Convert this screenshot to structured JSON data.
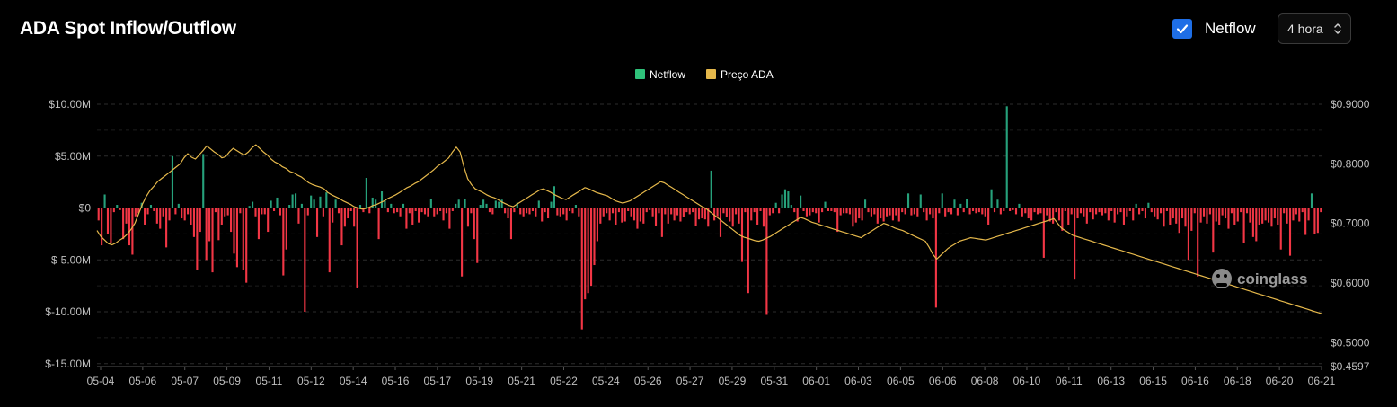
{
  "header": {
    "title": "ADA Spot Inflow/Outflow",
    "netflow_toggle": {
      "label": "Netflow",
      "checked": true
    },
    "interval_select": {
      "value": "4 hora"
    }
  },
  "watermark": "coinglass",
  "colors": {
    "inflow": "#26a17b",
    "outflow": "#f23645",
    "price": "#e5b84b",
    "legend_netflow": "#2fc27a",
    "grid": "#2c2c2c",
    "axis_text": "#bfbfbf",
    "checkbox": "#1e6ee6"
  },
  "chart_data": {
    "type": "bar",
    "title": "ADA Spot Inflow/Outflow",
    "legend": {
      "position": "top-center",
      "items": [
        "Netflow",
        "Preço ADA"
      ]
    },
    "x_ticks": [
      "05-04",
      "05-06",
      "05-07",
      "05-09",
      "05-11",
      "05-12",
      "05-14",
      "05-16",
      "05-17",
      "05-19",
      "05-21",
      "05-22",
      "05-24",
      "05-26",
      "05-27",
      "05-29",
      "05-31",
      "06-01",
      "06-03",
      "06-05",
      "06-06",
      "06-08",
      "06-10",
      "06-11",
      "06-13",
      "06-15",
      "06-16",
      "06-18",
      "06-20",
      "06-21"
    ],
    "y_left": {
      "ticks": [
        "$10.00M",
        "$5.00M",
        "$0",
        "$-5.00M",
        "$-10.00M",
        "$-15.00M"
      ],
      "range": [
        -15,
        10
      ],
      "unit": "M USD"
    },
    "y_right": {
      "ticks": [
        "$0.9000",
        "$0.8000",
        "$0.7000",
        "$0.6000",
        "$0.5000",
        "$0.4597"
      ],
      "range": [
        0.4597,
        0.9
      ]
    },
    "grid": true,
    "series": [
      {
        "name": "Netflow",
        "type": "bar",
        "x_start": "05-04",
        "interval": "4h",
        "values": [
          -1.2,
          -3.6,
          1.3,
          -2.5,
          -3.4,
          -0.4,
          0.3,
          -0.2,
          -3.0,
          -1.5,
          -3.6,
          -4.5,
          -0.8,
          -0.5,
          0.5,
          -1.6,
          -0.6,
          0.3,
          -0.3,
          -1.5,
          -2.0,
          -0.8,
          -3.8,
          -1.2,
          5.0,
          -0.6,
          0.4,
          -1.0,
          -1.2,
          -0.6,
          -1.6,
          -2.8,
          -6.0,
          -2.3,
          5.2,
          -5.0,
          -3.2,
          -6.2,
          -0.4,
          -3.1,
          -1.6,
          -0.8,
          -0.7,
          -2.3,
          -4.4,
          -5.7,
          -0.5,
          -6.0,
          -7.2,
          0.2,
          0.6,
          -0.8,
          -3.0,
          -0.6,
          -0.6,
          -2.3,
          0.7,
          -0.3,
          1.0,
          -0.7,
          -6.5,
          -4.0,
          0.3,
          1.3,
          1.4,
          -1.5,
          0.4,
          -10.0,
          -0.7,
          1.2,
          0.8,
          -2.8,
          1.1,
          -0.8,
          1.5,
          -6.2,
          -1.4,
          0.8,
          -0.5,
          -3.6,
          -1.8,
          -1.0,
          -0.3,
          -1.8,
          -7.7,
          0.3,
          -0.4,
          2.9,
          -0.5,
          1.0,
          0.8,
          -3.0,
          1.6,
          0.7,
          -0.4,
          0.4,
          -0.5,
          -0.4,
          -0.8,
          0.4,
          -2.0,
          -0.5,
          -1.6,
          -0.3,
          -1.4,
          -0.4,
          -0.6,
          -0.8,
          0.9,
          -0.8,
          -0.6,
          -0.3,
          -1.2,
          -0.5,
          -2.0,
          -0.3,
          0.4,
          0.8,
          -6.6,
          0.9,
          -1.8,
          -0.5,
          -3.0,
          -5.3,
          0.3,
          0.8,
          0.4,
          -0.4,
          -0.6,
          0.7,
          0.6,
          0.8,
          -0.5,
          -1.0,
          -3.0,
          -0.4,
          0.5,
          -0.6,
          -0.8,
          -0.5,
          -0.6,
          -0.3,
          -0.8,
          0.7,
          -1.3,
          -0.4,
          -1.0,
          0.6,
          2.1,
          -0.7,
          -0.8,
          -0.6,
          -1.2,
          -0.3,
          -0.5,
          0.3,
          -0.8,
          -11.7,
          -8.8,
          -8.2,
          -7.5,
          -5.5,
          -3.2,
          -1.5,
          -0.8,
          -0.5,
          -1.2,
          -0.5,
          -1.6,
          -0.4,
          -1.4,
          -1.3,
          -0.3,
          -0.8,
          -1.2,
          -2.0,
          -1.3,
          -1.5,
          -0.4,
          -0.2,
          -0.8,
          -1.7,
          -0.5,
          -2.8,
          -0.6,
          -1.5,
          -0.6,
          -1.2,
          -0.7,
          -1.3,
          -0.9,
          -0.4,
          -0.6,
          -0.4,
          -1.7,
          -1.1,
          -1.0,
          -1.1,
          -1.8,
          3.6,
          -1.2,
          -0.8,
          -2.8,
          -0.5,
          -0.9,
          -1.3,
          -1.8,
          -0.6,
          -1.5,
          -5.2,
          -0.4,
          -8.2,
          -1.2,
          -0.4,
          -1.6,
          -0.3,
          -1.8,
          -10.3,
          -0.7,
          -0.5,
          0.5,
          -0.5,
          1.3,
          1.8,
          1.6,
          0.3,
          -0.4,
          -1.3,
          1.2,
          -0.3,
          -0.8,
          -0.7,
          -0.4,
          -0.5,
          -1.4,
          -0.4,
          0.6,
          -0.3,
          -0.3,
          -0.4,
          -2.3,
          -0.7,
          -0.5,
          -0.5,
          -0.6,
          -1.8,
          -1.4,
          -1.0,
          -1.2,
          0.8,
          -0.4,
          -0.8,
          -0.6,
          -1.5,
          -1.0,
          -1.3,
          -0.8,
          -0.7,
          -1.2,
          -0.7,
          -1.3,
          -0.4,
          -0.6,
          1.4,
          -0.7,
          -0.6,
          -0.8,
          1.3,
          -0.4,
          -1.2,
          -0.6,
          -1.0,
          -9.6,
          -0.5,
          1.4,
          -0.8,
          -0.4,
          -0.6,
          0.8,
          -0.7,
          0.4,
          -0.4,
          0.9,
          -0.6,
          -0.3,
          -0.5,
          -0.4,
          -0.6,
          -0.8,
          -1.6,
          1.8,
          -0.4,
          0.8,
          -0.6,
          -0.3,
          9.8,
          -0.3,
          -0.2,
          -0.6,
          0.4,
          -0.8,
          -0.5,
          -1.0,
          -1.2,
          -0.4,
          -0.6,
          -0.5,
          -4.8,
          -0.7,
          -1.3,
          -1.5,
          -0.4,
          -1.2,
          -2.2,
          -0.3,
          -1.6,
          -0.6,
          -6.9,
          -1.0,
          -0.5,
          -0.8,
          -1.5,
          -0.4,
          -1.1,
          -0.6,
          -0.4,
          -0.7,
          -0.5,
          -1.2,
          -0.3,
          -1.4,
          -0.6,
          -0.4,
          -1.6,
          -0.8,
          -0.3,
          -1.2,
          0.4,
          -0.6,
          -0.3,
          -1.0,
          0.5,
          -0.4,
          -0.8,
          -1.1,
          -0.5,
          -1.8,
          -0.3,
          -1.6,
          -1.0,
          -1.5,
          -2.4,
          -1.0,
          -1.8,
          -5.0,
          -2.2,
          -0.5,
          -6.6,
          -1.4,
          -0.8,
          -1.5,
          -0.6,
          -4.3,
          -1.3,
          -1.6,
          -0.7,
          -1.0,
          -2.0,
          -0.5,
          -1.6,
          -1.3,
          -0.4,
          -3.4,
          -0.5,
          -1.4,
          -2.8,
          -3.2,
          -1.6,
          -1.5,
          -1.2,
          -1.4,
          -1.8,
          -1.0,
          -1.6,
          -4.0,
          -0.5,
          -1.5,
          -4.6,
          -1.2,
          -0.6,
          -1.3,
          -0.4,
          -2.6,
          -1.2,
          1.4,
          -2.5,
          -2.4,
          -0.4
        ]
      },
      {
        "name": "Preço ADA",
        "type": "line",
        "axis": "right",
        "values": [
          0.688,
          0.678,
          0.672,
          0.666,
          0.664,
          0.667,
          0.672,
          0.676,
          0.682,
          0.69,
          0.7,
          0.716,
          0.732,
          0.745,
          0.755,
          0.762,
          0.77,
          0.775,
          0.78,
          0.785,
          0.79,
          0.795,
          0.8,
          0.81,
          0.817,
          0.811,
          0.808,
          0.815,
          0.822,
          0.83,
          0.825,
          0.82,
          0.816,
          0.81,
          0.812,
          0.82,
          0.826,
          0.822,
          0.818,
          0.815,
          0.82,
          0.827,
          0.832,
          0.826,
          0.82,
          0.815,
          0.808,
          0.803,
          0.8,
          0.795,
          0.792,
          0.787,
          0.785,
          0.781,
          0.778,
          0.773,
          0.768,
          0.765,
          0.763,
          0.761,
          0.758,
          0.752,
          0.748,
          0.745,
          0.742,
          0.738,
          0.735,
          0.732,
          0.728,
          0.726,
          0.724,
          0.725,
          0.727,
          0.73,
          0.732,
          0.735,
          0.738,
          0.742,
          0.745,
          0.748,
          0.752,
          0.756,
          0.76,
          0.763,
          0.767,
          0.77,
          0.775,
          0.78,
          0.785,
          0.79,
          0.796,
          0.8,
          0.805,
          0.81,
          0.82,
          0.828,
          0.82,
          0.795,
          0.775,
          0.765,
          0.758,
          0.755,
          0.752,
          0.748,
          0.745,
          0.743,
          0.74,
          0.736,
          0.733,
          0.73,
          0.728,
          0.732,
          0.736,
          0.74,
          0.744,
          0.748,
          0.752,
          0.756,
          0.758,
          0.755,
          0.752,
          0.748,
          0.745,
          0.742,
          0.74,
          0.744,
          0.748,
          0.752,
          0.756,
          0.76,
          0.758,
          0.755,
          0.752,
          0.75,
          0.748,
          0.746,
          0.742,
          0.738,
          0.736,
          0.734,
          0.736,
          0.738,
          0.742,
          0.746,
          0.75,
          0.754,
          0.758,
          0.762,
          0.766,
          0.77,
          0.768,
          0.764,
          0.76,
          0.756,
          0.752,
          0.748,
          0.744,
          0.74,
          0.736,
          0.732,
          0.728,
          0.725,
          0.72,
          0.715,
          0.71,
          0.705,
          0.7,
          0.695,
          0.69,
          0.685,
          0.68,
          0.677,
          0.675,
          0.673,
          0.671,
          0.67,
          0.672,
          0.675,
          0.678,
          0.682,
          0.686,
          0.69,
          0.694,
          0.698,
          0.702,
          0.706,
          0.71,
          0.708,
          0.705,
          0.702,
          0.7,
          0.698,
          0.696,
          0.694,
          0.692,
          0.69,
          0.688,
          0.686,
          0.684,
          0.682,
          0.68,
          0.678,
          0.676,
          0.68,
          0.684,
          0.688,
          0.692,
          0.696,
          0.7,
          0.698,
          0.695,
          0.692,
          0.69,
          0.688,
          0.685,
          0.682,
          0.679,
          0.676,
          0.673,
          0.67,
          0.66,
          0.648,
          0.64,
          0.646,
          0.652,
          0.658,
          0.662,
          0.666,
          0.67,
          0.672,
          0.674,
          0.676,
          0.675,
          0.674,
          0.673,
          0.672,
          0.674,
          0.676,
          0.678,
          0.68,
          0.682,
          0.684,
          0.686,
          0.688,
          0.69,
          0.692,
          0.694,
          0.696,
          0.698,
          0.7,
          0.702,
          0.704,
          0.706,
          0.708,
          0.7,
          0.692,
          0.688,
          0.684,
          0.68,
          0.678,
          0.676,
          0.674,
          0.672,
          0.67,
          0.668,
          0.666,
          0.664,
          0.662,
          0.66,
          0.658,
          0.656,
          0.654,
          0.652,
          0.65,
          0.648,
          0.646,
          0.644,
          0.642,
          0.64,
          0.638,
          0.636,
          0.634,
          0.632,
          0.63,
          0.628,
          0.626,
          0.624,
          0.622,
          0.62,
          0.618,
          0.616,
          0.614,
          0.612,
          0.61,
          0.608,
          0.606,
          0.604,
          0.602,
          0.6,
          0.598,
          0.596,
          0.594,
          0.592,
          0.59,
          0.588,
          0.586,
          0.584,
          0.582,
          0.58,
          0.578,
          0.576,
          0.574,
          0.572,
          0.57,
          0.568,
          0.566,
          0.564,
          0.562,
          0.56,
          0.558,
          0.556,
          0.554,
          0.552,
          0.55,
          0.548
        ]
      }
    ]
  }
}
